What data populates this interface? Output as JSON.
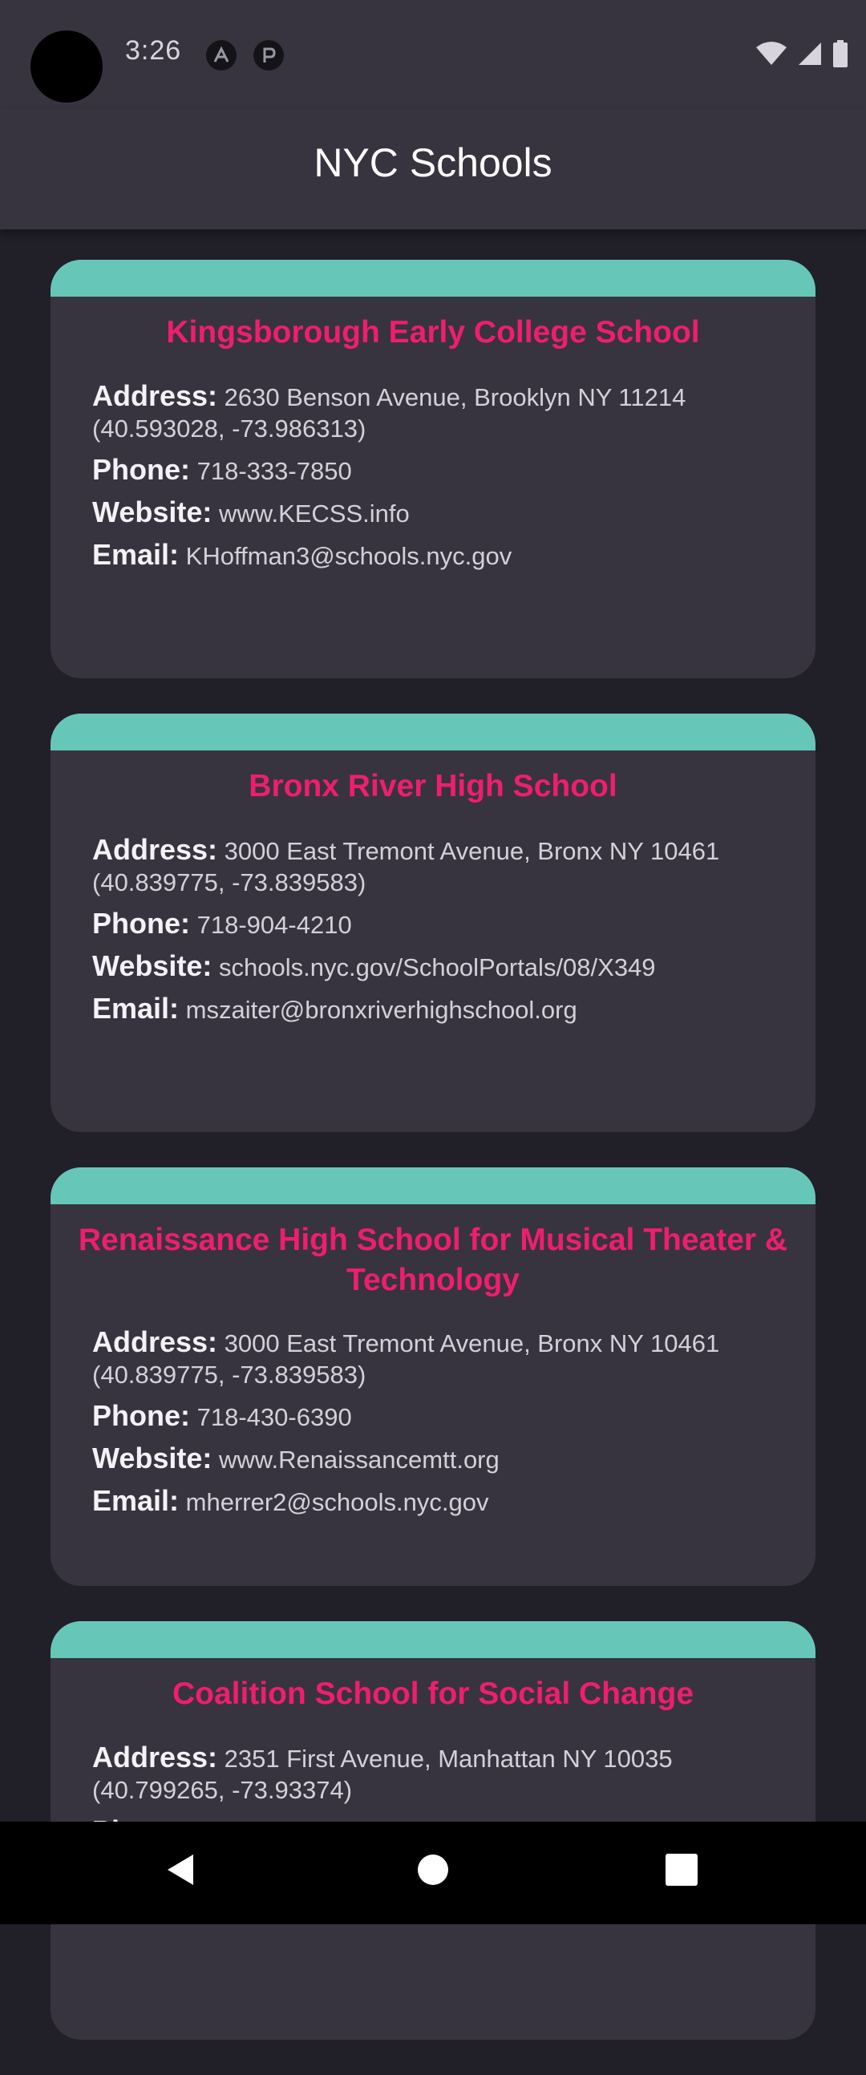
{
  "status_bar": {
    "time": "3:26",
    "icons": [
      "notification-a-icon",
      "notification-p-icon",
      "wifi-icon",
      "cell-signal-icon",
      "battery-icon"
    ]
  },
  "app_bar": {
    "title": "NYC Schools"
  },
  "labels": {
    "address": "Address:",
    "phone": "Phone:",
    "website": "Website:",
    "email": "Email:"
  },
  "schools": [
    {
      "name": "Kingsborough Early College School",
      "address": "2630 Benson Avenue, Brooklyn NY 11214 (40.593028, -73.986313)",
      "phone": "718-333-7850",
      "website": "www.KECSS.info",
      "email": "KHoffman3@schools.nyc.gov"
    },
    {
      "name": "Bronx River High School",
      "address": "3000 East Tremont Avenue, Bronx NY 10461 (40.839775, -73.839583)",
      "phone": "718-904-4210",
      "website": "schools.nyc.gov/SchoolPortals/08/X349",
      "email": "mszaiter@bronxriverhighschool.org"
    },
    {
      "name": "Renaissance High School for Musical Theater & Technology",
      "address": "3000 East Tremont Avenue, Bronx NY 10461 (40.839775, -73.839583)",
      "phone": "718-430-6390",
      "website": "www.Renaissancemtt.org",
      "email": "mherrer2@schools.nyc.gov"
    },
    {
      "name": "Coalition School for Social Change",
      "address": "2351 First Avenue, Manhattan NY 10035 (40.799265, -73.93374)"
    }
  ],
  "nav_bar": {
    "icons": [
      "back-icon",
      "home-icon",
      "recents-icon"
    ]
  },
  "colors": {
    "background": "#211f28",
    "surface": "#37343f",
    "accent_band": "#66c7b9",
    "title_pink": "#ef1d70"
  }
}
